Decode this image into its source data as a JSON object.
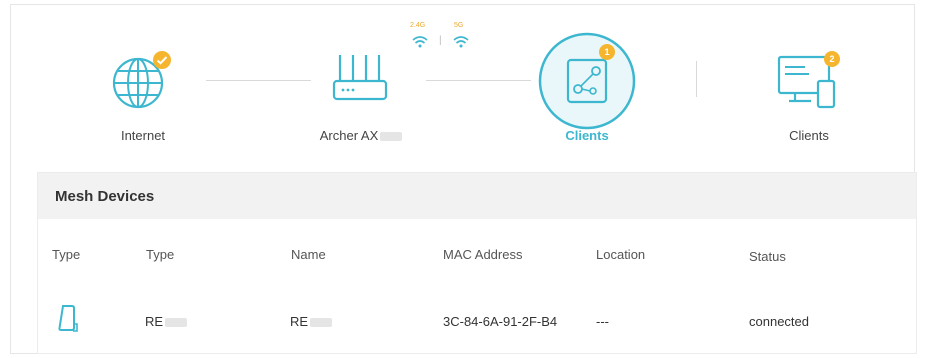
{
  "topology": {
    "internet_label": "Internet",
    "router_label": "Archer AX",
    "band_2g": "2.4G",
    "band_5g": "5G",
    "active_label": "Clients",
    "active_badge": "1",
    "clients_label": "Clients",
    "clients_badge": "2",
    "badge_color": "#f5b52e",
    "accent_color": "#3db7cf"
  },
  "mesh": {
    "title": "Mesh Devices",
    "columns": [
      "Type",
      "Type",
      "Name",
      "MAC Address",
      "Location",
      "Status"
    ],
    "rows": [
      {
        "device_icon": "extender-icon",
        "type": "RE",
        "name": "RE",
        "mac": "3C-84-6A-91-2F-B4",
        "location": "---",
        "status": "connected"
      }
    ]
  }
}
